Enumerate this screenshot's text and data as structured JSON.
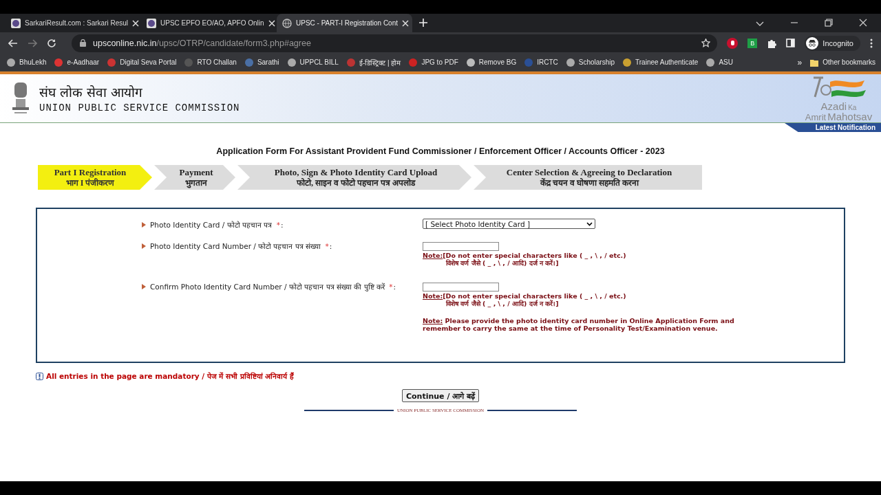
{
  "browser": {
    "tabs": [
      {
        "title": "SarkariResult.com : Sarkari Resul",
        "selected": false
      },
      {
        "title": "UPSC EPFO EO/AO, APFO Onlin",
        "selected": false
      },
      {
        "title": "UPSC - PART-I Registration Cont",
        "selected": true
      }
    ],
    "address": {
      "host": "upsconline.nic.in",
      "path": "/upsc/OTRP/candidate/form3.php#agree"
    },
    "extension_badge": "B",
    "profile": "Incognito",
    "bookmarks": [
      "BhuLekh",
      "e-Aadhaar",
      "Digital Seva Portal",
      "RTO Challan",
      "Sarathi",
      "UPPCL BILL",
      "ई-डिस्ट्रिक्ट | होम",
      "JPG to PDF",
      "Remove BG",
      "IRCTC",
      "Scholarship",
      "Trainee Authenticate",
      "ASU"
    ],
    "more_bookmarks": "»",
    "other_bookmarks": "Other bookmarks"
  },
  "header": {
    "title_hindi": "संघ लोक सेवा आयोग",
    "title": "UNION PUBLIC SERVICE COMMISSION",
    "logo_words": [
      "Azadi",
      "Ka",
      "Amrit",
      "Mahotsav"
    ],
    "latest_notification": "Latest Notification"
  },
  "form_title": "Application Form For Assistant Provident Fund Commissioner / Enforcement Officer / Accounts Officer - 2023",
  "steps": [
    {
      "line1": "Part I Registration",
      "line2": "भाग I पंजीकरण",
      "selected": true
    },
    {
      "line1": "Payment",
      "line2": "भुगतान",
      "selected": false
    },
    {
      "line1": "Photo, Sign & Photo Identity Card Upload",
      "line2": "फोटो, साइन व फोटो पहचान पत्र अपलोड",
      "selected": false
    },
    {
      "line1": "Center Selection & Agreeing to Declaration",
      "line2": "केंद्र चयन व घोषणा सहमति करना",
      "selected": false
    }
  ],
  "fields": [
    {
      "kind": "select",
      "label": "Photo Identity Card / फोटो पहचान पत्र",
      "required_mark": "*",
      "colon": ":",
      "value": "[ Select Photo Identity Card ]"
    },
    {
      "kind": "text",
      "label": "Photo Identity Card Number / फोटो पहचान पत्र संख्या",
      "required_mark": "*",
      "colon": ":",
      "note_label": "Note:",
      "note_lines": [
        "[Do not enter special characters like ( _ , \\ , / etc.)",
        "विशेष वर्ण जैसे ( _ , \\ , / आदि) दर्ज न करें।]"
      ]
    },
    {
      "kind": "text",
      "label": "Confirm Photo Identity Card Number / फोटो पहचान पत्र संख्या की पुष्टि करें",
      "required_mark": "*",
      "colon": ":",
      "note_label": "Note:",
      "note_lines": [
        "[Do not enter special characters like ( _ , \\ , / etc.)",
        "विशेष वर्ण जैसे ( _ , \\ , / आदि) दर्ज न करें।]"
      ]
    }
  ],
  "general_note": {
    "label": "Note:",
    "text": "Please provide the photo identity card number in Online Application Form and remember to carry the same at the time of Personality Test/Examination venue."
  },
  "mandatory_notice": "All entries in the page are mandatory / पेज में सभी प्रविष्टियां अनिवार्य हैं",
  "continue_button": "Continue / आगे बढ़ें",
  "footer": "UNION PUBLIC SERVICE COMMISSION"
}
